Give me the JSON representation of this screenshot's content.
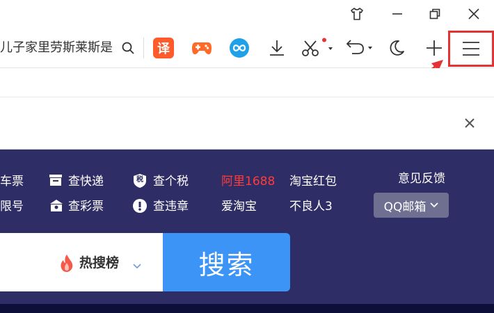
{
  "titlebar": {
    "skin_icon": "tshirt-icon",
    "minimize_icon": "minimize-icon",
    "restore_icon": "restore-icon",
    "close_icon": "close-icon"
  },
  "toolbar": {
    "address_text": "儿子家里劳斯莱斯是",
    "search_icon": "search-icon",
    "translate_label": "译",
    "translate_color": "#ff5a2b",
    "game_color": "#ff6a2b",
    "infinity_color": "#1fa0e8",
    "menu_highlight_color": "#e53333"
  },
  "page": {
    "links_col0": [
      "车票",
      "限号"
    ],
    "links_col1": [
      "查快递",
      "查彩票"
    ],
    "links_col2": [
      "查个税",
      "查违章"
    ],
    "tax_icon_label": "税",
    "links_col3": [
      "阿里1688",
      "爱淘宝"
    ],
    "links_col4": [
      "淘宝红包",
      "不良人3"
    ],
    "feedback": "意见反馈",
    "qq_mail": "QQ邮箱",
    "hot_label": "热搜榜",
    "search_button": "搜索",
    "highlight_color": "#ff3b3b",
    "search_button_color": "#3b94f6",
    "background_color": "#2f2d66"
  }
}
